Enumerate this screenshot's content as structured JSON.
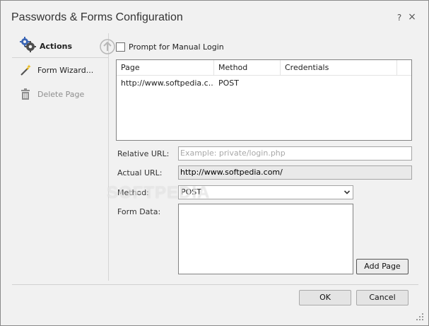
{
  "window": {
    "title": "Passwords & Forms Configuration",
    "help_label": "?",
    "close_label": "×"
  },
  "left": {
    "header_label": "Actions",
    "items": [
      {
        "label": "Form Wizard...",
        "icon": "magic-wand-icon",
        "enabled": true
      },
      {
        "label": "Delete Page",
        "icon": "trash-icon",
        "enabled": false
      }
    ]
  },
  "prompt_manual_login": {
    "label": "Prompt for Manual Login",
    "checked": false
  },
  "pages_table": {
    "columns": [
      "Page",
      "Method",
      "Credentials"
    ],
    "rows": [
      {
        "page": "http://www.softpedia.c...",
        "method": "POST",
        "credentials": ""
      }
    ]
  },
  "form": {
    "relative_url_label": "Relative URL:",
    "relative_url_placeholder": "Example: private/login.php",
    "actual_url_label": "Actual URL:",
    "actual_url_value": "http://www.softpedia.com/",
    "method_label": "Method:",
    "method_value": "POST",
    "form_data_label": "Form Data:",
    "add_page_label": "Add Page"
  },
  "footer": {
    "ok_label": "OK",
    "cancel_label": "Cancel"
  },
  "watermark": "SOFTPEDIA"
}
